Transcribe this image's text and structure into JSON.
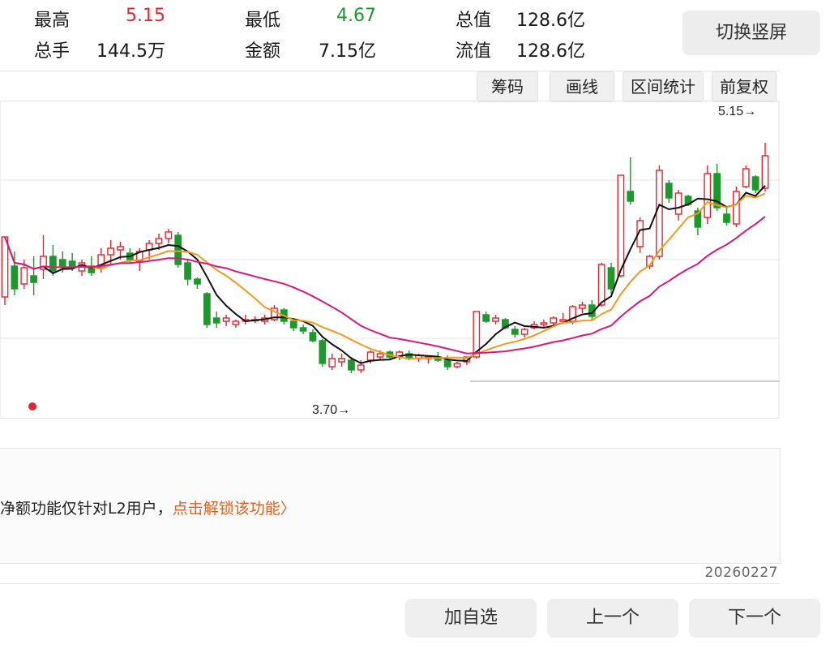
{
  "stats": {
    "high_label": "最高",
    "high_value": "5.15",
    "low_label": "最低",
    "low_value": "4.67",
    "total_cap_label": "总值",
    "total_cap_value": "128.6亿",
    "volume_label": "总手",
    "volume_value": "144.5万",
    "amount_label": "金额",
    "amount_value": "7.15亿",
    "float_cap_label": "流值",
    "float_cap_value": "128.6亿"
  },
  "switch_button": "切换竖屏",
  "toolbar": [
    "筹码",
    "画线",
    "区间统计",
    "前复权"
  ],
  "chart_data": {
    "type": "candlestick",
    "y_range": [
      3.45,
      5.35
    ],
    "max_label": "5.15→",
    "min_label": "3.70→",
    "up_color": "#e0262f",
    "down_color": "#1a9a2a",
    "ma_colors": [
      "#111111",
      "#f39a1d",
      "#d6197f"
    ],
    "candles": [
      [
        4.17,
        4.54,
        4.12,
        4.54
      ],
      [
        4.36,
        4.45,
        4.18,
        4.22
      ],
      [
        4.25,
        4.4,
        4.22,
        4.35
      ],
      [
        4.3,
        4.42,
        4.18,
        4.26
      ],
      [
        4.34,
        4.55,
        4.28,
        4.42
      ],
      [
        4.42,
        4.49,
        4.3,
        4.33
      ],
      [
        4.4,
        4.45,
        4.32,
        4.35
      ],
      [
        4.39,
        4.44,
        4.33,
        4.36
      ],
      [
        4.33,
        4.4,
        4.3,
        4.38
      ],
      [
        4.36,
        4.42,
        4.3,
        4.32
      ],
      [
        4.35,
        4.47,
        4.32,
        4.43
      ],
      [
        4.43,
        4.52,
        4.37,
        4.47
      ],
      [
        4.46,
        4.51,
        4.4,
        4.48
      ],
      [
        4.44,
        4.47,
        4.38,
        4.4
      ],
      [
        4.39,
        4.47,
        4.33,
        4.45
      ],
      [
        4.46,
        4.52,
        4.4,
        4.5
      ],
      [
        4.5,
        4.56,
        4.46,
        4.53
      ],
      [
        4.53,
        4.59,
        4.5,
        4.57
      ],
      [
        4.55,
        4.57,
        4.35,
        4.37
      ],
      [
        4.38,
        4.4,
        4.24,
        4.28
      ],
      [
        4.28,
        4.29,
        4.22,
        4.25
      ],
      [
        4.19,
        4.2,
        3.98,
        4.0
      ],
      [
        4.04,
        4.08,
        3.98,
        4.01
      ],
      [
        4.02,
        4.06,
        3.99,
        4.04
      ],
      [
        4.0,
        4.03,
        3.98,
        4.02
      ],
      [
        4.02,
        4.06,
        4.0,
        4.03
      ],
      [
        4.03,
        4.05,
        4.01,
        4.03
      ],
      [
        4.02,
        4.06,
        4.0,
        4.04
      ],
      [
        4.03,
        4.12,
        4.02,
        4.1
      ],
      [
        4.09,
        4.1,
        4.0,
        4.02
      ],
      [
        4.02,
        4.03,
        3.96,
        3.98
      ],
      [
        3.98,
        4.0,
        3.94,
        3.96
      ],
      [
        3.95,
        3.97,
        3.89,
        3.9
      ],
      [
        3.9,
        3.91,
        3.74,
        3.76
      ],
      [
        3.74,
        3.82,
        3.72,
        3.79
      ],
      [
        3.77,
        3.82,
        3.74,
        3.79
      ],
      [
        3.78,
        3.8,
        3.7,
        3.72
      ],
      [
        3.72,
        3.78,
        3.7,
        3.75
      ],
      [
        3.78,
        3.84,
        3.76,
        3.83
      ],
      [
        3.8,
        3.84,
        3.78,
        3.82
      ],
      [
        3.83,
        3.84,
        3.79,
        3.8
      ],
      [
        3.8,
        3.84,
        3.78,
        3.83
      ],
      [
        3.82,
        3.84,
        3.78,
        3.79
      ],
      [
        3.79,
        3.82,
        3.77,
        3.81
      ],
      [
        3.79,
        3.81,
        3.76,
        3.8
      ],
      [
        3.8,
        3.83,
        3.77,
        3.78
      ],
      [
        3.78,
        3.81,
        3.72,
        3.74
      ],
      [
        3.74,
        3.77,
        3.73,
        3.76
      ],
      [
        3.77,
        3.8,
        3.75,
        3.8
      ],
      [
        3.8,
        4.08,
        3.79,
        4.08
      ],
      [
        4.06,
        4.08,
        4.01,
        4.02
      ],
      [
        4.02,
        4.06,
        4.0,
        4.04
      ],
      [
        4.03,
        4.04,
        3.97,
        3.98
      ],
      [
        3.97,
        3.99,
        3.92,
        3.94
      ],
      [
        3.94,
        3.98,
        3.92,
        3.97
      ],
      [
        3.98,
        4.02,
        3.97,
        4.0
      ],
      [
        4.0,
        4.03,
        3.98,
        4.01
      ],
      [
        4.01,
        4.05,
        3.99,
        4.04
      ],
      [
        4.02,
        4.07,
        4.01,
        4.03
      ],
      [
        4.02,
        4.12,
        4.0,
        4.11
      ],
      [
        4.1,
        4.14,
        4.07,
        4.12
      ],
      [
        4.12,
        4.15,
        4.03,
        4.05
      ],
      [
        4.12,
        4.38,
        4.11,
        4.37
      ],
      [
        4.35,
        4.38,
        4.19,
        4.22
      ],
      [
        4.3,
        4.92,
        4.29,
        4.92
      ],
      [
        4.82,
        5.03,
        4.74,
        4.76
      ],
      [
        4.48,
        4.66,
        4.44,
        4.64
      ],
      [
        4.36,
        4.43,
        4.34,
        4.42
      ],
      [
        4.42,
        4.98,
        4.4,
        4.95
      ],
      [
        4.87,
        4.89,
        4.75,
        4.78
      ],
      [
        4.68,
        4.83,
        4.64,
        4.81
      ],
      [
        4.79,
        4.8,
        4.73,
        4.74
      ],
      [
        4.7,
        4.72,
        4.55,
        4.6
      ],
      [
        4.66,
        4.98,
        4.62,
        4.93
      ],
      [
        4.93,
        4.99,
        4.7,
        4.72
      ],
      [
        4.68,
        4.72,
        4.61,
        4.63
      ],
      [
        4.62,
        4.85,
        4.6,
        4.82
      ],
      [
        4.85,
        4.98,
        4.84,
        4.96
      ],
      [
        4.91,
        4.92,
        4.81,
        4.83
      ],
      [
        4.84,
        5.12,
        4.82,
        5.04
      ]
    ]
  },
  "info": {
    "text": "净额功能仅针对L2用户，",
    "link": "点击解锁该功能〉"
  },
  "date": "20260227",
  "nav": {
    "add_favorite": "加自选",
    "prev": "上一个",
    "next": "下一个"
  }
}
